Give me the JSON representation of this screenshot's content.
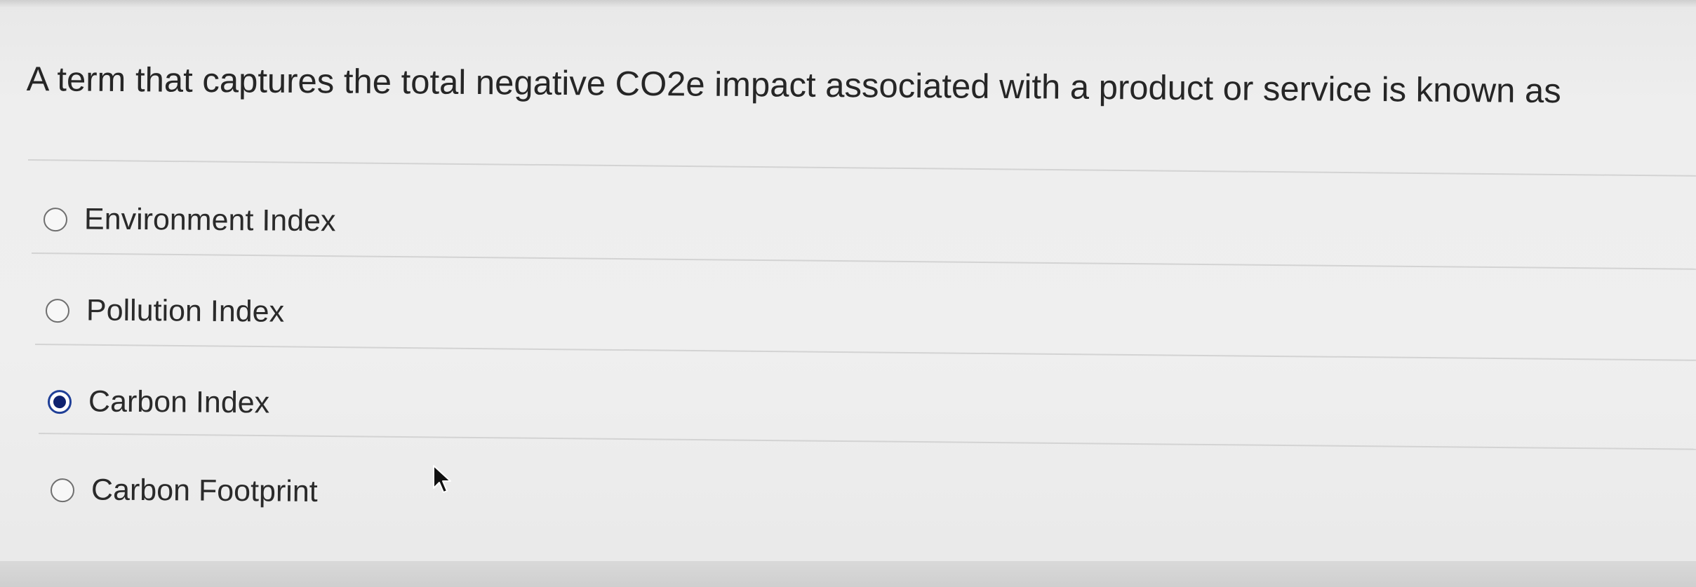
{
  "question": {
    "text": "A term that captures the total negative CO2e impact associated with a product or service is known as"
  },
  "options": [
    {
      "label": "Environment Index",
      "selected": false
    },
    {
      "label": "Pollution Index",
      "selected": false
    },
    {
      "label": "Carbon Index",
      "selected": true
    },
    {
      "label": "Carbon Footprint",
      "selected": false
    }
  ],
  "colors": {
    "background": "#eeeeee",
    "text": "#262626",
    "divider": "#d3d3d3",
    "radio_selected": "#0f226f"
  },
  "icons": {
    "pointer": "arrow-cursor-icon"
  }
}
